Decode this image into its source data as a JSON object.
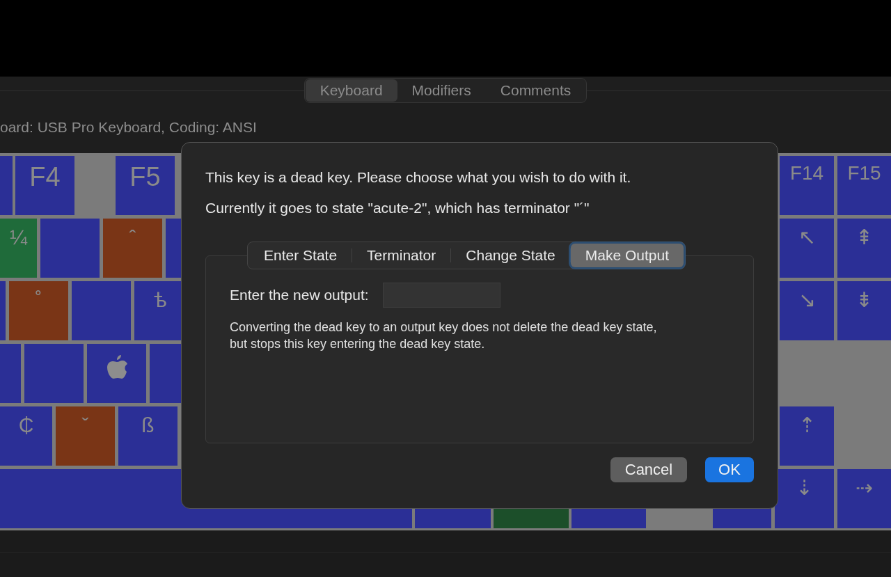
{
  "tabs": [
    {
      "label": "Keyboard",
      "selected": true
    },
    {
      "label": "Modifiers",
      "selected": false
    },
    {
      "label": "Comments",
      "selected": false
    }
  ],
  "status": "oard: USB Pro Keyboard, Coding: ANSI",
  "keyboard": {
    "keys": [
      {
        "color": "#2b2f96"
      },
      {
        "label": "F4",
        "color": "#2b2f96"
      },
      {
        "label": "F5",
        "color": "#2b2f96"
      },
      {
        "label": "F14",
        "color": "#2b2f96"
      },
      {
        "label": "F15",
        "color": "#2b2f96"
      },
      {
        "label": "¼",
        "color": "#1f6b3a"
      },
      {
        "color": "#2b2f96"
      },
      {
        "label": "ˆ",
        "color": "#7a3516"
      },
      {
        "color": "#2b2f96"
      },
      {
        "label": "↖",
        "color": "#2b2f96"
      },
      {
        "label": "⇞",
        "color": "#2b2f96"
      },
      {
        "color": "#2b2f96"
      },
      {
        "label": "˚",
        "color": "#7a3516"
      },
      {
        "color": "#2b2f96"
      },
      {
        "label": "ѣ",
        "color": "#2b2f96"
      },
      {
        "label": "↘",
        "color": "#2b2f96"
      },
      {
        "label": "⇟",
        "color": "#2b2f96"
      },
      {
        "color": "#2b2f96"
      },
      {
        "color": "#2b2f96"
      },
      {
        "kind": "apple",
        "color": "#2b2f96"
      },
      {
        "color": "#2b2f96"
      },
      {
        "label": "₵",
        "color": "#2b2f96"
      },
      {
        "label": "ˇ",
        "color": "#7a3516"
      },
      {
        "label": "ß",
        "color": "#2b2f96"
      },
      {
        "label": "⇡",
        "color": "#2b2f96"
      },
      {
        "color": "#2b2f96"
      },
      {
        "color": "#2b2f96"
      },
      {
        "color": "#1c4f2a"
      },
      {
        "color": "#2b2f96"
      },
      {
        "color": "#2b2f96"
      },
      {
        "label": "⇣",
        "color": "#2b2f96"
      },
      {
        "label": "⇢",
        "color": "#2b2f96"
      }
    ]
  },
  "dialog": {
    "message": "This key is a dead key. Please choose what you wish to do with it.",
    "state_info": "Currently it goes to state \"acute-2\", which has terminator \"´\"",
    "tabs": [
      {
        "label": "Enter State",
        "selected": false
      },
      {
        "label": "Terminator",
        "selected": false
      },
      {
        "label": "Change State",
        "selected": false
      },
      {
        "label": "Make Output",
        "selected": true
      }
    ],
    "field_label": "Enter the new output:",
    "description": "Converting the dead key to an output key does not delete the dead key state, but stops this key entering the dead key state.",
    "buttons": [
      {
        "label": "Cancel",
        "kind": "secondary"
      },
      {
        "label": "OK",
        "kind": "default"
      }
    ]
  }
}
